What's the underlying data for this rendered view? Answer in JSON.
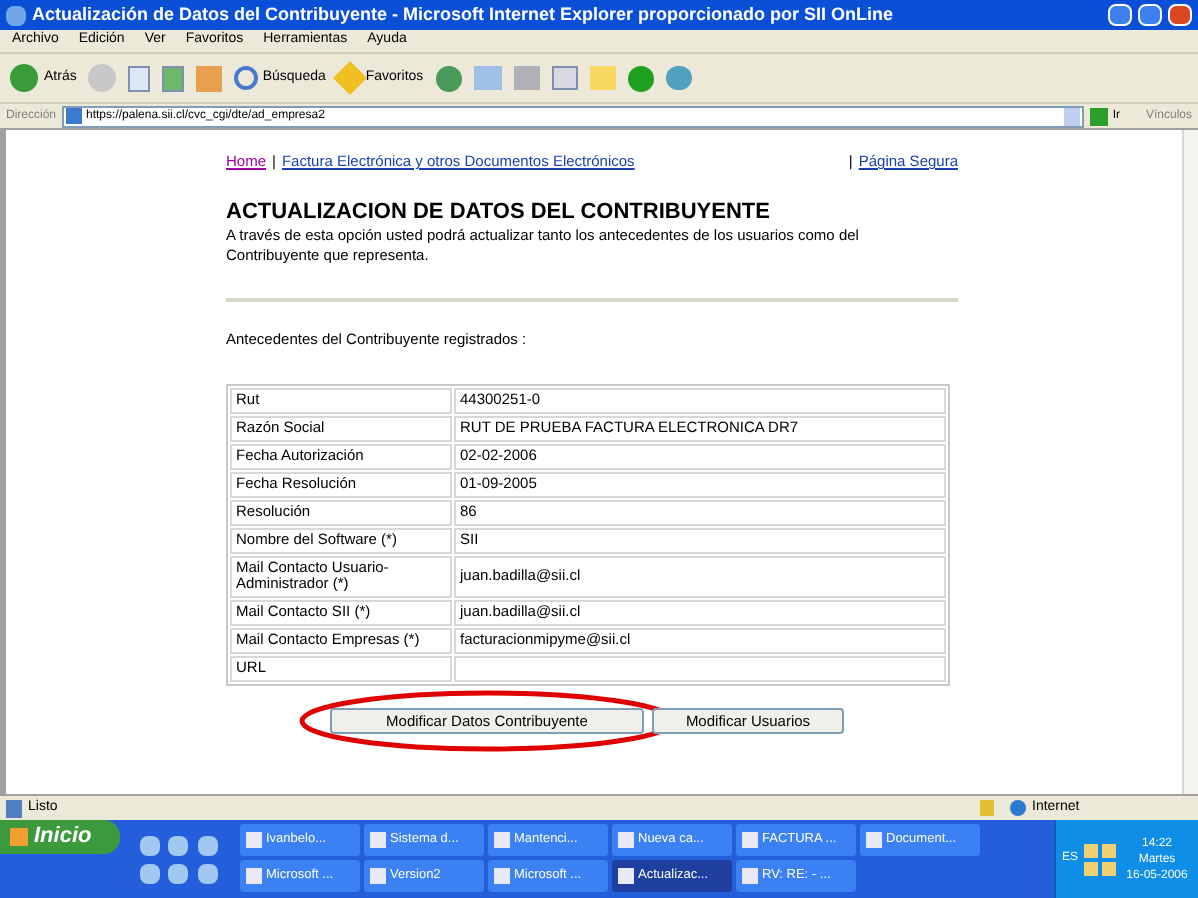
{
  "window": {
    "title": "Actualización de Datos del Contribuyente - Microsoft Internet Explorer proporcionado por SII OnLine"
  },
  "menu": [
    "Archivo",
    "Edición",
    "Ver",
    "Favoritos",
    "Herramientas",
    "Ayuda"
  ],
  "toolbar": {
    "back": "Atrás",
    "search": "Búsqueda",
    "favorites": "Favoritos"
  },
  "address_bar": {
    "label": "Dirección",
    "value": "https://palena.sii.cl/cvc_cgi/dte/ad_empresa2",
    "go": "Ir",
    "links": "Vínculos"
  },
  "page": {
    "nav_left": [
      {
        "kind": "link",
        "text": "Home",
        "visited": true
      },
      {
        "kind": "sep",
        "text": "|"
      },
      {
        "kind": "link",
        "text": "Factura Electrónica y otros Documentos Electrónicos",
        "visited": false
      }
    ],
    "nav_right": [
      {
        "kind": "sep",
        "text": "|"
      },
      {
        "kind": "link",
        "text": "Página Segura",
        "visited": false
      }
    ],
    "heading": "ACTUALIZACION DE DATOS DEL CONTRIBUYENTE",
    "intro": "A través de esta opción usted podrá actualizar tanto los antecedentes de los usuarios como del Contribuyente que representa.",
    "section_label": "Antecedentes del Contribuyente registrados :",
    "table": {
      "rows": [
        {
          "label": "Rut",
          "value": "44300251-0"
        },
        {
          "label": "Razón Social",
          "value": "RUT DE PRUEBA FACTURA ELECTRONICA DR7"
        },
        {
          "label": "Fecha Autorización",
          "value": "02-02-2006"
        },
        {
          "label": "Fecha Resolución",
          "value": "01-09-2005"
        },
        {
          "label": "Resolución",
          "value": "86"
        },
        {
          "label": "Nombre del Software (*)",
          "value": "SII"
        },
        {
          "label": "Mail Contacto Usuario-Administrador (*)",
          "value": "juan.badilla@sii.cl"
        },
        {
          "label": "Mail Contacto SII (*)",
          "value": "juan.badilla@sii.cl"
        },
        {
          "label": "Mail Contacto Empresas (*)",
          "value": "facturacionmipyme@sii.cl"
        },
        {
          "label": "URL"
        }
      ]
    },
    "buttons": [
      {
        "text": "Modificar Datos Contribuyente",
        "circled": true
      },
      {
        "text": "Modificar Usuarios",
        "circled": false
      }
    ]
  },
  "status_bar": {
    "text": "Listo",
    "zone": "Internet"
  },
  "taskbar": {
    "start": "Inicio",
    "tasks": [
      [
        {
          "text": "Ivanbelo...",
          "selected": false
        },
        {
          "text": "Sistema d...",
          "selected": false
        },
        {
          "text": "Mantenci...",
          "selected": false
        },
        {
          "text": "Nueva ca...",
          "selected": false
        },
        {
          "text": "FACTURA ...",
          "selected": false
        },
        {
          "text": "Document...",
          "selected": false
        }
      ],
      [
        {
          "text": "Microsoft ...",
          "selected": false
        },
        {
          "text": "Version2",
          "selected": false
        },
        {
          "text": "Microsoft ...",
          "selected": false
        },
        {
          "text": "Actualizac...",
          "selected": true
        },
        {
          "text": "RV: RE: - ...",
          "selected": false
        }
      ]
    ],
    "language": "ES",
    "time": "14:22",
    "day": "Martes",
    "date": "16-05-2006"
  }
}
